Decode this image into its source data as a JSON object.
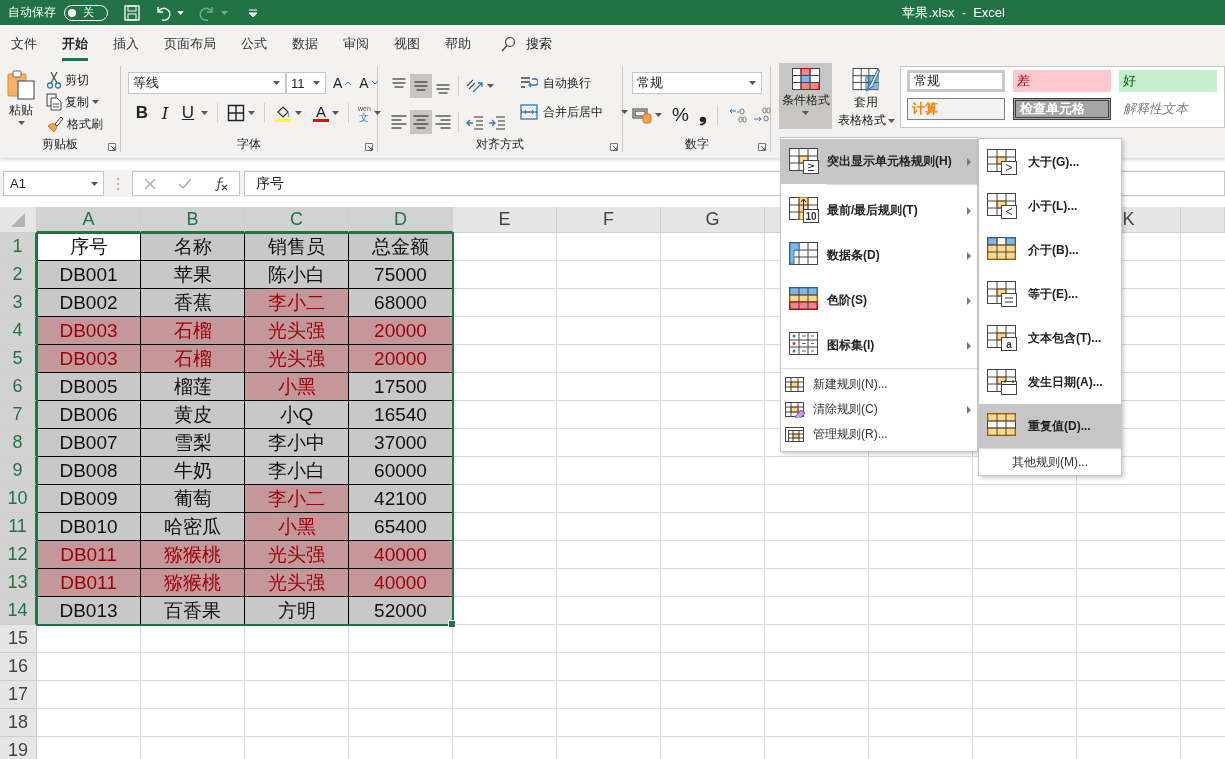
{
  "title_bar": {
    "autosave_label": "自动保存",
    "autosave_on": false,
    "autosave_state": "关",
    "title": "苹果.xlsx  -  Excel"
  },
  "tabs": [
    {
      "label": "文件",
      "selected": false
    },
    {
      "label": "开始",
      "selected": true
    },
    {
      "label": "插入",
      "selected": false
    },
    {
      "label": "页面布局",
      "selected": false
    },
    {
      "label": "公式",
      "selected": false
    },
    {
      "label": "数据",
      "selected": false
    },
    {
      "label": "审阅",
      "selected": false
    },
    {
      "label": "视图",
      "selected": false
    },
    {
      "label": "帮助",
      "selected": false
    }
  ],
  "search": {
    "label": "搜索"
  },
  "ribbon": {
    "clipboard": {
      "paste": "粘贴",
      "cut": "剪切",
      "copy": "复制",
      "format_painter": "格式刷",
      "group_label": "剪贴板"
    },
    "font": {
      "font_name": "等线",
      "font_size": "11",
      "grow_glyph": "A",
      "shrink_glyph": "A",
      "bold_glyph": "B",
      "italic_glyph": "I",
      "underline_glyph": "U",
      "color_glyph": "A",
      "phonetic_glyph": "文",
      "phonetic_ruby": "wén",
      "group_label": "字体"
    },
    "alignment": {
      "buttons": [
        {
          "kind": "top",
          "selected": false
        },
        {
          "kind": "middle",
          "selected": true
        },
        {
          "kind": "bottom",
          "selected": false
        },
        {
          "kind": "left",
          "selected": false
        },
        {
          "kind": "center",
          "selected": true
        },
        {
          "kind": "right",
          "selected": false
        }
      ],
      "wrap_text": "自动换行",
      "merge_center": "合并后居中",
      "group_label": "对齐方式"
    },
    "number": {
      "format": "常规",
      "percent_glyph": "%",
      "comma_glyph": "❟",
      "group_label": "数字"
    },
    "styles": {
      "conditional_formatting": "条件格式",
      "conditional_formatting_open": true,
      "format_as_table": [
        "套用",
        "表格格式"
      ],
      "cell_styles": [
        {
          "label": "常规",
          "kind": "normal"
        },
        {
          "label": "差",
          "kind": "bad"
        },
        {
          "label": "好",
          "kind": "good"
        },
        {
          "label": "计算",
          "kind": "calculation"
        },
        {
          "label": "检查单元格",
          "kind": "check"
        },
        {
          "label": "解释性文本",
          "kind": "explanatory"
        }
      ]
    }
  },
  "formula_bar": {
    "name_box": "A1",
    "formula": "序号"
  },
  "sheet": {
    "columns": [
      {
        "label": "A",
        "selected": true
      },
      {
        "label": "B",
        "selected": true
      },
      {
        "label": "C",
        "selected": true
      },
      {
        "label": "D",
        "selected": true
      },
      {
        "label": "E",
        "selected": false
      },
      {
        "label": "F",
        "selected": false
      },
      {
        "label": "G",
        "selected": false
      },
      {
        "selected": false
      },
      {},
      {},
      {
        "label": "K",
        "selected": false
      }
    ],
    "rows": [
      {
        "header": "1",
        "selected": true,
        "cells": [
          {
            "text": "序号",
            "highlighted": false,
            "selected": true
          },
          {
            "text": "名称",
            "highlighted": false,
            "selected": false
          },
          {
            "text": "销售员",
            "highlighted": false,
            "selected": false
          },
          {
            "text": "总金额",
            "highlighted": false,
            "selected": false
          }
        ]
      },
      {
        "header": "2",
        "selected": true,
        "cells": [
          {
            "text": "DB001",
            "highlighted": false,
            "selected": false
          },
          {
            "text": "苹果",
            "highlighted": false,
            "selected": false
          },
          {
            "text": "陈小白",
            "highlighted": false,
            "selected": false
          },
          {
            "text": "75000",
            "highlighted": false,
            "selected": false
          }
        ]
      },
      {
        "header": "3",
        "selected": true,
        "cells": [
          {
            "text": "DB002",
            "highlighted": false,
            "selected": false
          },
          {
            "text": "香蕉",
            "highlighted": false,
            "selected": false
          },
          {
            "text": "李小二",
            "highlighted": true,
            "selected": false
          },
          {
            "text": "68000",
            "highlighted": false,
            "selected": false
          }
        ]
      },
      {
        "header": "4",
        "selected": true,
        "cells": [
          {
            "text": "DB003",
            "highlighted": true,
            "selected": false
          },
          {
            "text": "石榴",
            "highlighted": true,
            "selected": false
          },
          {
            "text": "光头强",
            "highlighted": true,
            "selected": false
          },
          {
            "text": "20000",
            "highlighted": true,
            "selected": false
          }
        ]
      },
      {
        "header": "5",
        "selected": true,
        "cells": [
          {
            "text": "DB003",
            "highlighted": true,
            "selected": false
          },
          {
            "text": "石榴",
            "highlighted": true,
            "selected": false
          },
          {
            "text": "光头强",
            "highlighted": true,
            "selected": false
          },
          {
            "text": "20000",
            "highlighted": true,
            "selected": false
          }
        ]
      },
      {
        "header": "6",
        "selected": true,
        "cells": [
          {
            "text": "DB005",
            "highlighted": false,
            "selected": false
          },
          {
            "text": "榴莲",
            "highlighted": false,
            "selected": false
          },
          {
            "text": "小黑",
            "highlighted": true,
            "selected": false
          },
          {
            "text": "17500",
            "highlighted": false,
            "selected": false
          }
        ]
      },
      {
        "header": "7",
        "selected": true,
        "cells": [
          {
            "text": "DB006",
            "highlighted": false,
            "selected": false
          },
          {
            "text": "黄皮",
            "highlighted": false,
            "selected": false
          },
          {
            "text": "小Q",
            "highlighted": false,
            "selected": false
          },
          {
            "text": "16540",
            "highlighted": false,
            "selected": false
          }
        ]
      },
      {
        "header": "8",
        "selected": true,
        "cells": [
          {
            "text": "DB007",
            "highlighted": false,
            "selected": false
          },
          {
            "text": "雪梨",
            "highlighted": false,
            "selected": false
          },
          {
            "text": "李小中",
            "highlighted": false,
            "selected": false
          },
          {
            "text": "37000",
            "highlighted": false,
            "selected": false
          }
        ]
      },
      {
        "header": "9",
        "selected": true,
        "cells": [
          {
            "text": "DB008",
            "highlighted": false,
            "selected": false
          },
          {
            "text": "牛奶",
            "highlighted": false,
            "selected": false
          },
          {
            "text": "李小白",
            "highlighted": false,
            "selected": false
          },
          {
            "text": "60000",
            "highlighted": false,
            "selected": false
          }
        ]
      },
      {
        "header": "10",
        "selected": true,
        "cells": [
          {
            "text": "DB009",
            "highlighted": false,
            "selected": false
          },
          {
            "text": "葡萄",
            "highlighted": false,
            "selected": false
          },
          {
            "text": "李小二",
            "highlighted": true,
            "selected": false
          },
          {
            "text": "42100",
            "highlighted": false,
            "selected": false
          }
        ]
      },
      {
        "header": "11",
        "selected": true,
        "cells": [
          {
            "text": "DB010",
            "highlighted": false,
            "selected": false
          },
          {
            "text": "哈密瓜",
            "highlighted": false,
            "selected": false
          },
          {
            "text": "小黑",
            "highlighted": true,
            "selected": false
          },
          {
            "text": "65400",
            "highlighted": false,
            "selected": false
          }
        ]
      },
      {
        "header": "12",
        "selected": true,
        "cells": [
          {
            "text": "DB011",
            "highlighted": true,
            "selected": false
          },
          {
            "text": "猕猴桃",
            "highlighted": true,
            "selected": false
          },
          {
            "text": "光头强",
            "highlighted": true,
            "selected": false
          },
          {
            "text": "40000",
            "highlighted": true,
            "selected": false
          }
        ]
      },
      {
        "header": "13",
        "selected": true,
        "cells": [
          {
            "text": "DB011",
            "highlighted": true,
            "selected": false
          },
          {
            "text": "猕猴桃",
            "highlighted": true,
            "selected": false
          },
          {
            "text": "光头强",
            "highlighted": true,
            "selected": false
          },
          {
            "text": "40000",
            "highlighted": true,
            "selected": false
          }
        ]
      },
      {
        "header": "14",
        "selected": true,
        "cells": [
          {
            "text": "DB013",
            "highlighted": false,
            "selected": false
          },
          {
            "text": "百香果",
            "highlighted": false,
            "selected": false
          },
          {
            "text": "方明",
            "highlighted": false,
            "selected": false
          },
          {
            "text": "52000",
            "highlighted": false,
            "selected": false
          }
        ]
      },
      {
        "header": "15",
        "selected": false
      },
      {
        "header": "16",
        "selected": false
      },
      {
        "header": "17",
        "selected": false
      },
      {
        "header": "18",
        "selected": false
      },
      {
        "header": "19",
        "selected": false
      }
    ]
  },
  "menu": {
    "items": [
      {
        "label": "突出显示单元格规则(H)",
        "kind": "highlight",
        "large": true,
        "submenu": true,
        "selected": true
      },
      {
        "label": "最前/最后规则(T)",
        "kind": "topbottom",
        "large": true,
        "submenu": true,
        "selected": false,
        "icon_text": "10"
      },
      {
        "label": "数据条(D)",
        "kind": "databar",
        "large": true,
        "submenu": true,
        "selected": false
      },
      {
        "label": "色阶(S)",
        "kind": "colorscale",
        "large": true,
        "submenu": true,
        "selected": false
      },
      {
        "label": "图标集(I)",
        "kind": "iconset",
        "large": true,
        "submenu": true,
        "selected": false
      },
      {
        "label": "新建规则(N)...",
        "kind": "new",
        "large": false,
        "submenu": false,
        "selected": false
      },
      {
        "label": "清除规则(C)",
        "kind": "clear",
        "large": false,
        "submenu": true,
        "selected": false
      },
      {
        "label": "管理规则(R)...",
        "kind": "manage",
        "large": false,
        "submenu": false,
        "selected": false
      }
    ],
    "submenu": {
      "items": [
        {
          "label": "大于(G)...",
          "kind": "greater",
          "selected": false
        },
        {
          "label": "小于(L)...",
          "kind": "less",
          "selected": false
        },
        {
          "label": "介于(B)...",
          "kind": "between",
          "selected": false
        },
        {
          "label": "等于(E)...",
          "kind": "equal",
          "selected": false
        },
        {
          "label": "文本包含(T)...",
          "kind": "text",
          "selected": false,
          "icon_text": "a"
        },
        {
          "label": "发生日期(A)...",
          "kind": "date",
          "selected": false
        },
        {
          "label": "重复值(D)...",
          "kind": "duplicate",
          "selected": true
        }
      ],
      "footer": "其他规则(M)..."
    }
  }
}
